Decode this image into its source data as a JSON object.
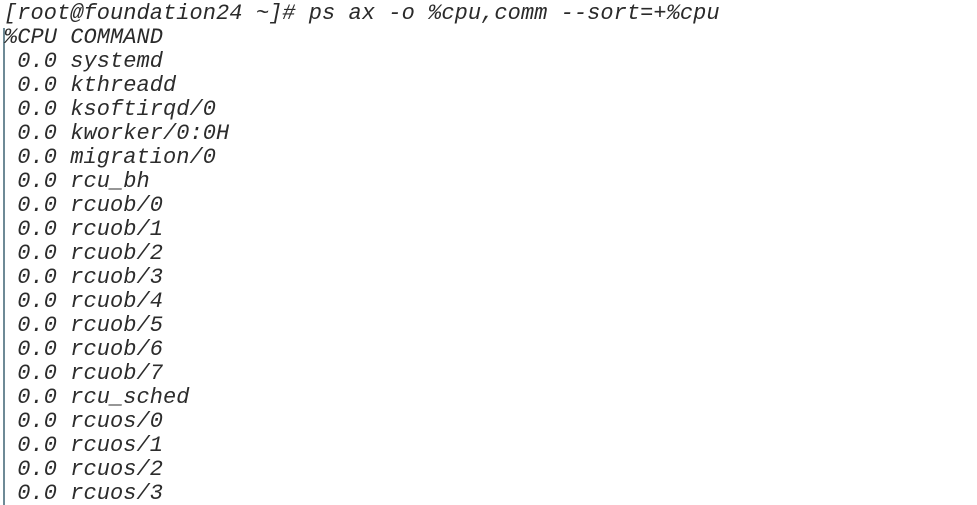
{
  "terminal": {
    "title": "Terminal",
    "background_color": "#ffffff",
    "text_color": "#2c2c2c",
    "rule_color": "#6e8a96",
    "prompt": {
      "user": "root",
      "host": "foundation24",
      "cwd": "~",
      "symbol": "#",
      "full_prompt": "[root@foundation24 ~]#",
      "command": "ps ax -o %cpu,comm --sort=+%cpu",
      "full_line": "[root@foundation24 ~]# ps ax -o %cpu,comm --sort=+%cpu"
    },
    "output": {
      "header": "%CPU COMMAND",
      "columns": [
        "%CPU",
        "COMMAND"
      ],
      "rows": [
        {
          "cpu": "0.0",
          "command": "systemd",
          "line": " 0.0 systemd"
        },
        {
          "cpu": "0.0",
          "command": "kthreadd",
          "line": " 0.0 kthreadd"
        },
        {
          "cpu": "0.0",
          "command": "ksoftirqd/0",
          "line": " 0.0 ksoftirqd/0"
        },
        {
          "cpu": "0.0",
          "command": "kworker/0:0H",
          "line": " 0.0 kworker/0:0H"
        },
        {
          "cpu": "0.0",
          "command": "migration/0",
          "line": " 0.0 migration/0"
        },
        {
          "cpu": "0.0",
          "command": "rcu_bh",
          "line": " 0.0 rcu_bh"
        },
        {
          "cpu": "0.0",
          "command": "rcuob/0",
          "line": " 0.0 rcuob/0"
        },
        {
          "cpu": "0.0",
          "command": "rcuob/1",
          "line": " 0.0 rcuob/1"
        },
        {
          "cpu": "0.0",
          "command": "rcuob/2",
          "line": " 0.0 rcuob/2"
        },
        {
          "cpu": "0.0",
          "command": "rcuob/3",
          "line": " 0.0 rcuob/3"
        },
        {
          "cpu": "0.0",
          "command": "rcuob/4",
          "line": " 0.0 rcuob/4"
        },
        {
          "cpu": "0.0",
          "command": "rcuob/5",
          "line": " 0.0 rcuob/5"
        },
        {
          "cpu": "0.0",
          "command": "rcuob/6",
          "line": " 0.0 rcuob/6"
        },
        {
          "cpu": "0.0",
          "command": "rcuob/7",
          "line": " 0.0 rcuob/7"
        },
        {
          "cpu": "0.0",
          "command": "rcu_sched",
          "line": " 0.0 rcu_sched"
        },
        {
          "cpu": "0.0",
          "command": "rcuos/0",
          "line": " 0.0 rcuos/0"
        },
        {
          "cpu": "0.0",
          "command": "rcuos/1",
          "line": " 0.0 rcuos/1"
        },
        {
          "cpu": "0.0",
          "command": "rcuos/2",
          "line": " 0.0 rcuos/2"
        },
        {
          "cpu": "0.0",
          "command": "rcuos/3",
          "line": " 0.0 rcuos/3"
        }
      ]
    }
  }
}
